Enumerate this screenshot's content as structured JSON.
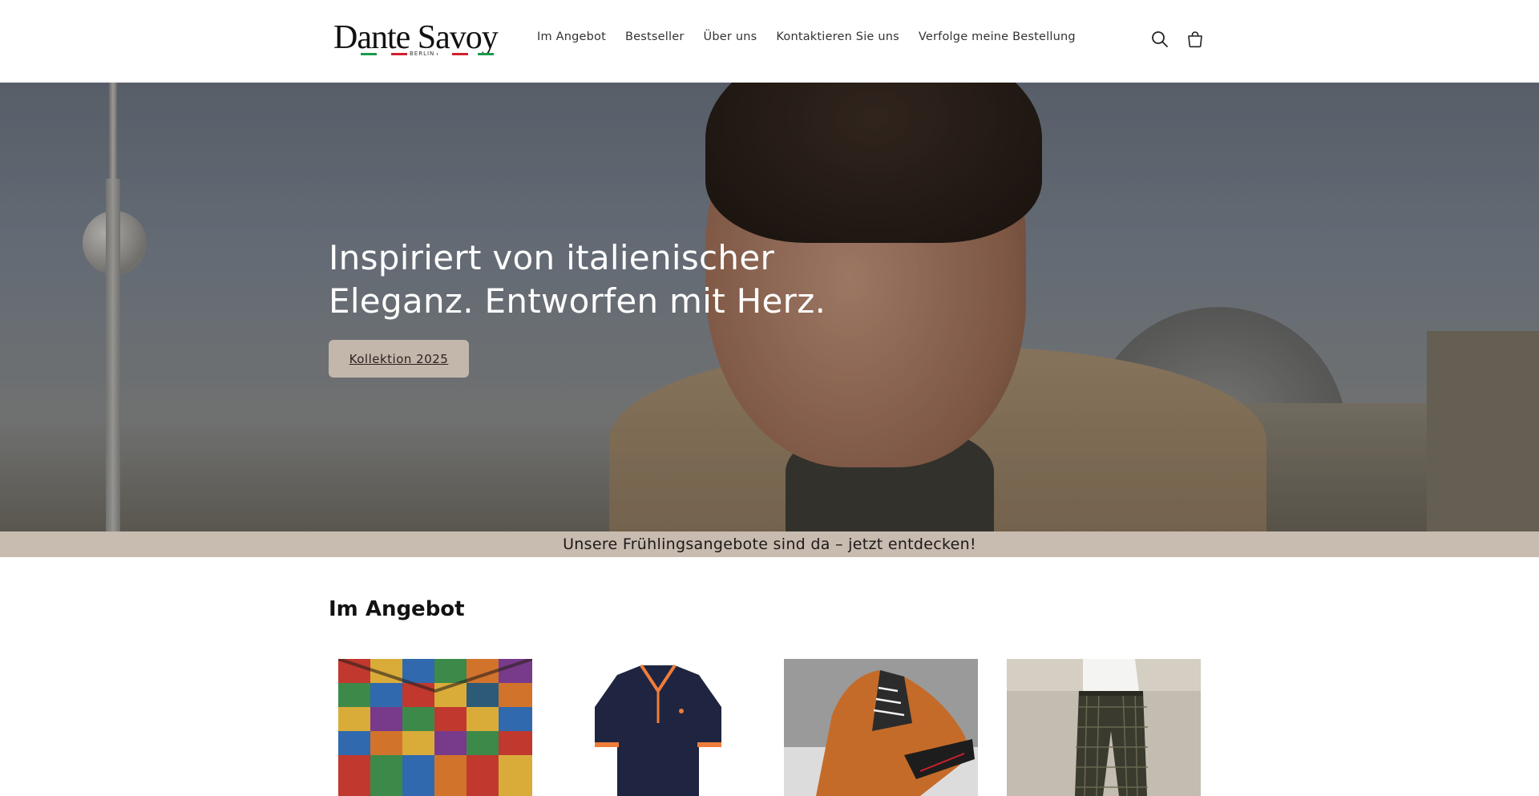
{
  "header": {
    "logo": {
      "name": "Dante Savoy",
      "subtitle": "BERLIN"
    },
    "nav": [
      {
        "label": "Im Angebot"
      },
      {
        "label": "Bestseller"
      },
      {
        "label": "Über uns"
      },
      {
        "label": "Kontaktieren Sie uns"
      },
      {
        "label": "Verfolge meine Bestellung"
      }
    ],
    "icons": {
      "search": "search-icon",
      "cart": "cart-icon"
    }
  },
  "hero": {
    "title": "Inspiriert von italienischer Eleganz. Entworfen mit Herz.",
    "button_label": "Kollektion 2025"
  },
  "announcement": {
    "text": "Unsere Frühlingsangebote sind da – jetzt entdecken!"
  },
  "section": {
    "title": "Im Angebot",
    "products": [
      {
        "image": "patchwork-shirt"
      },
      {
        "image": "navy-polo-shirt"
      },
      {
        "image": "brown-sneaker"
      },
      {
        "image": "plaid-trousers"
      }
    ]
  },
  "colors": {
    "accent_button": "#c3b6ab",
    "announcement_bg": "#c8bbb0",
    "logo_stripe_green": "#1a9b4b",
    "logo_stripe_red": "#d0202e"
  }
}
